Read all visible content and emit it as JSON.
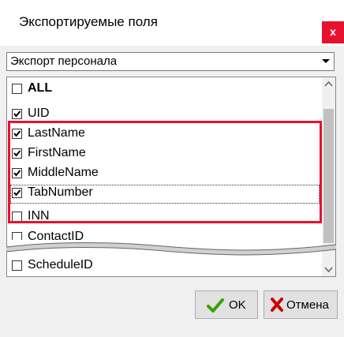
{
  "window": {
    "title": "Экспортируемые поля",
    "close_glyph": "x"
  },
  "preset": {
    "selected": "Экспорт персонала"
  },
  "fields": [
    {
      "label": "ALL",
      "checked": false,
      "bold": true
    },
    {
      "label": "UID",
      "checked": true
    },
    {
      "label": "LastName",
      "checked": true
    },
    {
      "label": "FirstName",
      "checked": true
    },
    {
      "label": "MiddleName",
      "checked": true
    },
    {
      "label": "TabNumber",
      "checked": true,
      "focused": true
    },
    {
      "label": "INN",
      "checked": false
    },
    {
      "label": "ContactID",
      "checked": false
    },
    {
      "label": "ScheduleID",
      "checked": false
    }
  ],
  "buttons": {
    "ok_label": "OK",
    "cancel_label": "Отмена"
  },
  "colors": {
    "highlight": "#e8112d",
    "ok_icon": "#3aa000",
    "cancel_icon": "#cc0000"
  }
}
